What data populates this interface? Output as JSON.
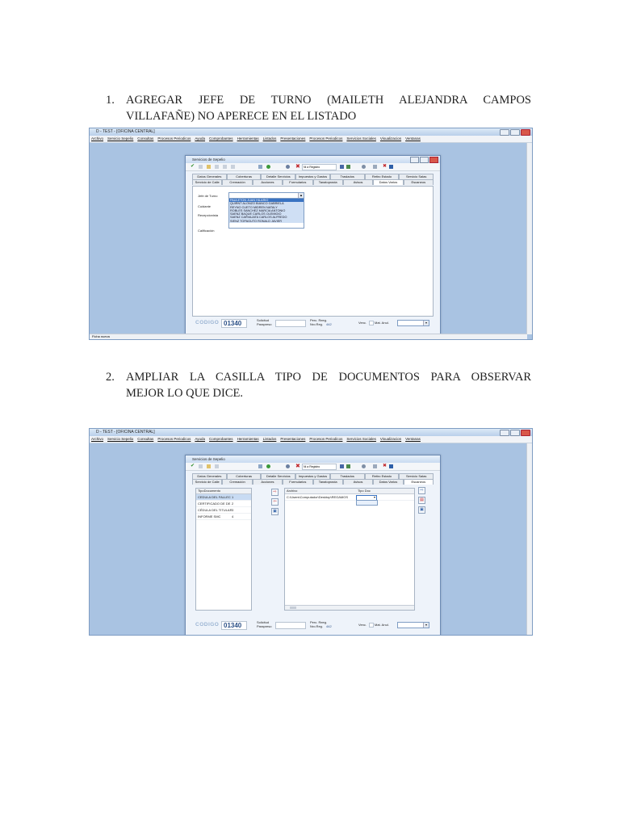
{
  "items": [
    {
      "num": "1.",
      "lines": [
        "AGREGAR JEFE DE TURNO (MAILETH ALEJANDRA CAMPOS",
        "VILLAFAÑE) NO APERECE EN EL LISTADO"
      ]
    },
    {
      "num": "2.",
      "lines": [
        "AMPLIAR LA CASILLA TIPO DE DOCUMENTOS PARA OBSERVAR",
        "MEJOR LO QUE DICE."
      ]
    }
  ],
  "app": {
    "title": "D - TEST - [OFICINA CENTRAL]",
    "menu": [
      "Archivo",
      "Servicio Sepelio",
      "Consultas",
      "Procesos Periodicos",
      "Ayuda",
      "Comprobantes",
      "Herramientas",
      "Listados",
      "Presentaciones",
      "Procesos Periodicos",
      "Servicios Sociales",
      "Visualizacion",
      "Ventanas"
    ],
    "status": "Ficha nueva"
  },
  "dialog": {
    "title": "Servicios de Sepelio",
    "toolbar_search": "Ni a Registro",
    "tabs_row1": [
      "Datos Generales",
      "Coberturas",
      "Detalle Servicios",
      "Impuestos y Gastos",
      "Traslados",
      "Retiro Estado",
      "Servicio Salas"
    ],
    "tabs_row2": [
      "Servicio de Calle",
      "Cremación",
      "Acciones",
      "Formularios",
      "Tanatopraxia",
      "Avisos",
      "Datos Varios",
      "Escaneos"
    ],
    "codigo_label": "CODIGO",
    "codigo_value": "01340",
    "solicitud_label": "Solicitud",
    "solicitud_sub": "Parapreso",
    "perc_label": "Perc. Reeg.",
    "nro_label": "Nro.Reg.",
    "nro_value": "442",
    "venc_label": "Venc.",
    "matanul_label": "Mat. Anul."
  },
  "shot1": {
    "labels": [
      "Jefe de Turno",
      "Cuidante",
      "Recepcionista",
      "Calificación"
    ],
    "list": [
      "PAULETON JUAN HILARIO",
      "QUIRNT ALONZO BIANCO GABRIELA",
      "REYNO CUETO MIDREN NATALY",
      "ROBLES SANCHEZ MARCIA ANTONIO",
      "SAENZ BAQUE CARLOS OLEMIGIO",
      "SAENZ CARVAJATA CARLOS ALFREDO",
      "SIENZ TOPAGUTO RONALD JAVIER"
    ]
  },
  "shot2": {
    "table_header": "TipoDocumento",
    "rows": [
      {
        "name": "CEDULA DEL FALLEC",
        "n": "1"
      },
      {
        "name": "CERTIFICADO DE DE",
        "n": "2"
      },
      {
        "name": "CÉDULA DEL TITULAR",
        "n": "3"
      },
      {
        "name": "INFORME SMC",
        "n": "4"
      }
    ],
    "archivo_header": "Archivo",
    "tipodoc_header": "Tipo Doc",
    "archivo_path": "C:\\Users\\Computador\\Desktop\\REGAMOS"
  }
}
